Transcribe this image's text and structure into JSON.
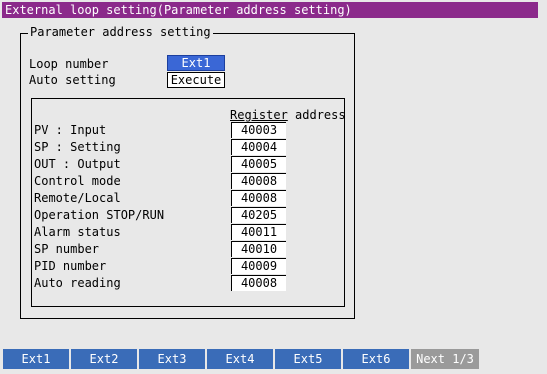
{
  "window": {
    "title": "External loop setting(Parameter address setting)"
  },
  "group": {
    "legend": "Parameter address setting",
    "loop_number_label": "Loop number",
    "loop_number_value": "Ext1",
    "auto_setting_label": "Auto setting",
    "auto_setting_value": "Execute"
  },
  "registers": {
    "header_a": "Register",
    "header_b": " address",
    "rows": [
      {
        "label": "PV : Input",
        "value": "40003"
      },
      {
        "label": "SP : Setting",
        "value": "40004"
      },
      {
        "label": "OUT : Output",
        "value": "40005"
      },
      {
        "label": "Control mode",
        "value": "40008"
      },
      {
        "label": "Remote/Local",
        "value": "40008"
      },
      {
        "label": "Operation STOP/RUN",
        "value": "40205"
      },
      {
        "label": "Alarm status",
        "value": "40011"
      },
      {
        "label": "SP number",
        "value": "40010"
      },
      {
        "label": "PID number",
        "value": "40009"
      },
      {
        "label": "Auto reading",
        "value": "40008"
      }
    ]
  },
  "softkeys": [
    "Ext1",
    "Ext2",
    "Ext3",
    "Ext4",
    "Ext5",
    "Ext6",
    "Next 1/3"
  ]
}
